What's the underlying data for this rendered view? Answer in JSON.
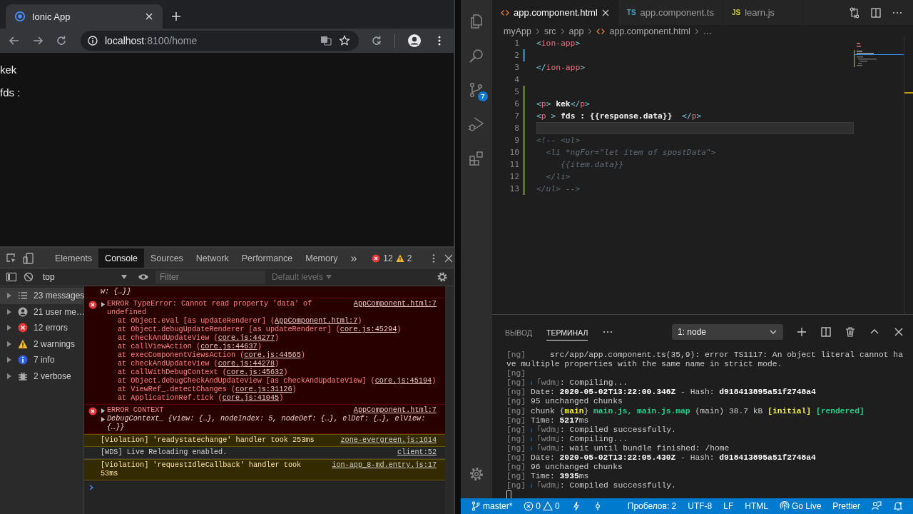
{
  "browser": {
    "tabs": [
      {
        "title": "Ionic App",
        "selected": true
      }
    ],
    "address": {
      "host": "localhost",
      "path": ":8100/home"
    },
    "page": {
      "paragraphs": [
        "kek",
        "fds :"
      ]
    }
  },
  "devtools": {
    "tabs": [
      {
        "label": "Elements",
        "selected": false
      },
      {
        "label": "Console",
        "selected": true
      },
      {
        "label": "Sources",
        "selected": false
      },
      {
        "label": "Network",
        "selected": false
      },
      {
        "label": "Performance",
        "selected": false
      },
      {
        "label": "Memory",
        "selected": false
      }
    ],
    "more": "»",
    "error_count": "12",
    "warning_count": "2",
    "context": "top",
    "filter_placeholder": "Filter",
    "levels": "Default levels",
    "sidebar": [
      {
        "label": "23 messages",
        "kind": "messages",
        "selected": true
      },
      {
        "label": "21 user me…",
        "kind": "user",
        "selected": false
      },
      {
        "label": "12 errors",
        "kind": "errors",
        "selected": false
      },
      {
        "label": "2 warnings",
        "kind": "warnings",
        "selected": false
      },
      {
        "label": "7 info",
        "kind": "info",
        "selected": false
      },
      {
        "label": "2 verbose",
        "kind": "verbose",
        "selected": false
      }
    ],
    "messages": [
      {
        "kind": "error",
        "detail": "w: {…}}"
      },
      {
        "kind": "error",
        "icon": true,
        "expandable": true,
        "head": "ERROR TypeError: Cannot read property 'data' of undefined",
        "source": "AppComponent.html:7",
        "stack": [
          {
            "call": "at Object.eval [as updateRenderer] (",
            "link": "AppComponent.html:7",
            "end": ")"
          },
          {
            "call": "at Object.debugUpdateRenderer [as updateRenderer] (",
            "link": "core.js:45294",
            "end": ")"
          },
          {
            "call": "at checkAndUpdateView (",
            "link": "core.js:44277",
            "end": ")"
          },
          {
            "call": "at callViewAction (",
            "link": "core.js:44637",
            "end": ")"
          },
          {
            "call": "at execComponentViewsAction (",
            "link": "core.js:44565",
            "end": ")"
          },
          {
            "call": "at checkAndUpdateView (",
            "link": "core.js:44278",
            "end": ")"
          },
          {
            "call": "at callWithDebugContext (",
            "link": "core.js:45632",
            "end": ")"
          },
          {
            "call": "at Object.debugCheckAndUpdateView [as checkAndUpdateView] (",
            "link": "core.js:45194",
            "end": ")"
          },
          {
            "call": "at ViewRef_.detectChanges (",
            "link": "core.js:31126",
            "end": ")"
          },
          {
            "call": "at ApplicationRef.tick (",
            "link": "core.js:41045",
            "end": ")"
          }
        ]
      },
      {
        "kind": "error",
        "icon": true,
        "expandable": true,
        "head": "ERROR CONTEXT",
        "source": "AppComponent.html:7",
        "detail": "DebugContext_ {view: {…}, nodeIndex: 5, nodeDef: {…}, elDef: {…}, elView: {…}}",
        "detail_expandable": true
      },
      {
        "kind": "warning",
        "head": "[Violation] 'readystatechange' handler took 253ms",
        "source": "zone-evergreen.js:1614"
      },
      {
        "kind": "info",
        "head": "[WDS] Live Reloading enabled.",
        "source": "client:52"
      },
      {
        "kind": "warning",
        "head": "[Violation] 'requestIdleCallback' handler took 53ms",
        "source": "ion-app_8-md.entry.js:17"
      }
    ]
  },
  "editor": {
    "activity": [
      {
        "kind": "explorer"
      },
      {
        "kind": "search"
      },
      {
        "kind": "scm",
        "badge": "7"
      },
      {
        "kind": "debug"
      },
      {
        "kind": "extensions"
      }
    ],
    "tabs": [
      {
        "label": "app.component.html",
        "kind": "html",
        "selected": true
      },
      {
        "label": "app.component.ts",
        "kind": "ts",
        "badge": "TS",
        "selected": false
      },
      {
        "label": "learn.js",
        "kind": "js",
        "badge": "JS",
        "selected": false
      }
    ],
    "breadcrumb": [
      {
        "label": "myApp"
      },
      {
        "label": "src"
      },
      {
        "label": "app"
      },
      {
        "label": "app.component.html",
        "kind": "html"
      },
      {
        "label": "…"
      }
    ],
    "lines": [
      {
        "number": "1",
        "current": false,
        "segments": [
          {
            "t": "<",
            "kind": "punct"
          },
          {
            "t": "ion-app",
            "kind": "tag"
          },
          {
            "t": ">",
            "kind": "punct"
          }
        ]
      },
      {
        "number": "2",
        "current": false,
        "kind": "modified"
      },
      {
        "number": "3",
        "current": false,
        "segments": [
          {
            "t": "</",
            "kind": "punct"
          },
          {
            "t": "ion-app",
            "kind": "tag"
          },
          {
            "t": ">",
            "kind": "punct"
          }
        ]
      },
      {
        "number": "4",
        "current": false
      },
      {
        "number": "5",
        "current": false,
        "kind": "added"
      },
      {
        "number": "6",
        "current": false,
        "kind": "added",
        "segments": [
          {
            "t": "<",
            "kind": "punct"
          },
          {
            "t": "p",
            "kind": "tag"
          },
          {
            "t": ">",
            "kind": "punct"
          },
          {
            "t": " kek",
            "kind": "text"
          },
          {
            "t": "</",
            "kind": "punct"
          },
          {
            "t": "p",
            "kind": "tag"
          },
          {
            "t": ">",
            "kind": "punct"
          }
        ]
      },
      {
        "number": "7",
        "current": false,
        "kind": "added",
        "segments": [
          {
            "t": "<",
            "kind": "punct"
          },
          {
            "t": "p",
            "kind": "tag"
          },
          {
            "t": " >",
            "kind": "punct"
          },
          {
            "t": " fds : {{response.data}}  ",
            "kind": "text"
          },
          {
            "t": "</",
            "kind": "punct"
          },
          {
            "t": "p",
            "kind": "tag"
          },
          {
            "t": ">",
            "kind": "punct"
          }
        ]
      },
      {
        "number": "8",
        "current": true,
        "kind": "added"
      },
      {
        "number": "9",
        "current": false,
        "kind": "added",
        "segments": [
          {
            "t": "<!-- <ul>",
            "kind": "comment"
          }
        ]
      },
      {
        "number": "10",
        "current": false,
        "kind": "added",
        "segments": [
          {
            "t": "  <li *ngFor=\"let item of spostData\">",
            "kind": "comment"
          }
        ]
      },
      {
        "number": "11",
        "current": false,
        "kind": "added",
        "segments": [
          {
            "t": "     {{item.data}}",
            "kind": "comment"
          }
        ]
      },
      {
        "number": "12",
        "current": false,
        "kind": "added",
        "segments": [
          {
            "t": "  </li>",
            "kind": "comment"
          }
        ]
      },
      {
        "number": "13",
        "current": false,
        "kind": "added",
        "segments": [
          {
            "t": "</ul> -->",
            "kind": "comment"
          }
        ]
      }
    ]
  },
  "panel": {
    "tabs": [
      {
        "label": "ВЫВОД",
        "selected": false
      },
      {
        "label": "ТЕРМИНАЛ",
        "selected": true
      }
    ],
    "terminal_select": "1: node",
    "terminal": [
      [
        {
          "t": "[ng]",
          "kind": "dim"
        },
        {
          "t": "     src/app/app.component.ts(35,9): error TS1117: An object literal cannot have multiple properties with the same name in strict mode.",
          "kind": "plain"
        }
      ],
      [
        {
          "t": "[ng]",
          "kind": "dim"
        }
      ],
      [
        {
          "t": "[ng] ",
          "kind": "dim"
        },
        {
          "t": "ℹ",
          "kind": "info"
        },
        {
          "t": " ｢wdm｣",
          "kind": "dim"
        },
        {
          "t": ": Compiling...",
          "kind": "plain"
        }
      ],
      [
        {
          "t": "[ng] ",
          "kind": "dim"
        },
        {
          "t": "Date: ",
          "kind": "plain"
        },
        {
          "t": "2020-05-02T13:22:00.346Z",
          "kind": "bold"
        },
        {
          "t": " - Hash: ",
          "kind": "plain"
        },
        {
          "t": "d918413895a51f2748a4",
          "kind": "bold"
        }
      ],
      [
        {
          "t": "[ng] ",
          "kind": "dim"
        },
        {
          "t": "95 unchanged chunks",
          "kind": "plain"
        }
      ],
      [
        {
          "t": "[ng] ",
          "kind": "dim"
        },
        {
          "t": "chunk {",
          "kind": "plain"
        },
        {
          "t": "main",
          "kind": "yellow"
        },
        {
          "t": "} ",
          "kind": "plain"
        },
        {
          "t": "main.js, main.js.map",
          "kind": "green"
        },
        {
          "t": " (main) 38.7 kB ",
          "kind": "plain"
        },
        {
          "t": "[initial]",
          "kind": "yellow"
        },
        {
          "t": " [rendered]",
          "kind": "green"
        }
      ],
      [
        {
          "t": "[ng] ",
          "kind": "dim"
        },
        {
          "t": "Time: ",
          "kind": "plain"
        },
        {
          "t": "5217",
          "kind": "bold"
        },
        {
          "t": "ms",
          "kind": "plain"
        }
      ],
      [
        {
          "t": "[ng] ",
          "kind": "dim"
        },
        {
          "t": "ℹ",
          "kind": "info"
        },
        {
          "t": " ｢wdm｣",
          "kind": "dim"
        },
        {
          "t": ": Compiled successfully.",
          "kind": "plain"
        }
      ],
      [
        {
          "t": "[ng] ",
          "kind": "dim"
        },
        {
          "t": "ℹ",
          "kind": "info"
        },
        {
          "t": " ｢wdm｣",
          "kind": "dim"
        },
        {
          "t": ": Compiling...",
          "kind": "plain"
        }
      ],
      [
        {
          "t": "[ng] ",
          "kind": "dim"
        },
        {
          "t": "ℹ",
          "kind": "info"
        },
        {
          "t": " ｢wdm｣",
          "kind": "dim"
        },
        {
          "t": ": wait until bundle finished: /home",
          "kind": "plain"
        }
      ],
      [
        {
          "t": "[ng] ",
          "kind": "dim"
        },
        {
          "t": "Date: ",
          "kind": "plain"
        },
        {
          "t": "2020-05-02T13:22:05.430Z",
          "kind": "bold"
        },
        {
          "t": " - Hash: ",
          "kind": "plain"
        },
        {
          "t": "d918413895a51f2748a4",
          "kind": "bold"
        }
      ],
      [
        {
          "t": "[ng] ",
          "kind": "dim"
        },
        {
          "t": "96 unchanged chunks",
          "kind": "plain"
        }
      ],
      [
        {
          "t": "[ng] ",
          "kind": "dim"
        },
        {
          "t": "Time: ",
          "kind": "plain"
        },
        {
          "t": "3935",
          "kind": "bold"
        },
        {
          "t": "ms",
          "kind": "plain"
        }
      ],
      [
        {
          "t": "[ng] ",
          "kind": "dim"
        },
        {
          "t": "ℹ",
          "kind": "info"
        },
        {
          "t": " ｢wdm｣",
          "kind": "dim"
        },
        {
          "t": ": Compiled successfully.",
          "kind": "plain"
        }
      ]
    ]
  },
  "status_bar": {
    "left": [
      {
        "kind": "branch",
        "label": "master*"
      },
      {
        "kind": "problems",
        "errors": "0",
        "warnings": "0"
      },
      {
        "kind": "bolt"
      },
      {
        "kind": "commit"
      }
    ],
    "right": [
      {
        "kind": "text",
        "label": "Пробелов: 2"
      },
      {
        "kind": "text",
        "label": "UTF-8"
      },
      {
        "kind": "text",
        "label": "LF"
      },
      {
        "kind": "text",
        "label": "HTML"
      },
      {
        "kind": "golive",
        "label": "Go Live"
      },
      {
        "kind": "text",
        "label": "Prettier"
      },
      {
        "kind": "feedback"
      },
      {
        "kind": "bell"
      }
    ]
  }
}
